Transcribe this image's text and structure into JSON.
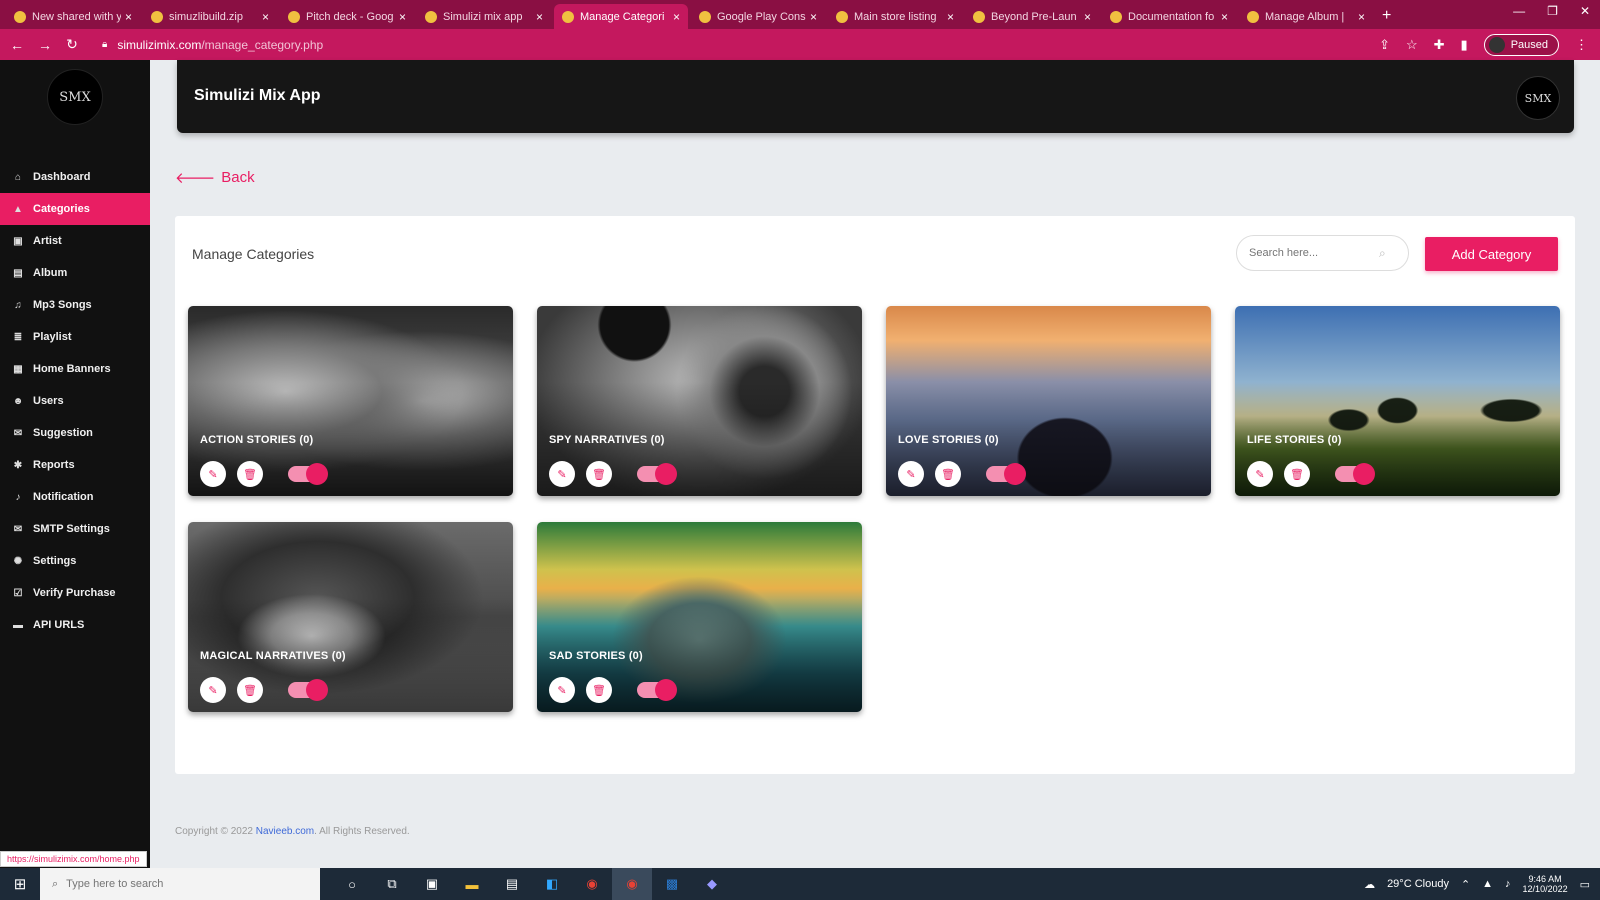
{
  "browser": {
    "tabs": [
      {
        "label": "New shared with y",
        "active": false
      },
      {
        "label": "simuzlibuild.zip",
        "active": false
      },
      {
        "label": "Pitch deck - Goog",
        "active": false
      },
      {
        "label": "Simulizi mix app",
        "active": false
      },
      {
        "label": "Manage Categori",
        "active": true
      },
      {
        "label": "Google Play Cons",
        "active": false
      },
      {
        "label": "Main store listing",
        "active": false
      },
      {
        "label": "Beyond Pre-Laun",
        "active": false
      },
      {
        "label": "Documentation fo",
        "active": false
      },
      {
        "label": "Manage Album |",
        "active": false
      }
    ],
    "url_host": "simulizimix.com",
    "url_path": "/manage_category.php",
    "profile_label": "Paused",
    "status_url": "https://simulizimix.com/home.php"
  },
  "sidebar": {
    "logo_text": "SMX",
    "items": [
      {
        "label": "Dashboard",
        "icon": "home-icon",
        "glyph": "⌂",
        "active": false
      },
      {
        "label": "Categories",
        "icon": "triangle-icon",
        "glyph": "▲",
        "active": true
      },
      {
        "label": "Artist",
        "icon": "user-icon",
        "glyph": "▣",
        "active": false
      },
      {
        "label": "Album",
        "icon": "image-icon",
        "glyph": "▤",
        "active": false
      },
      {
        "label": "Mp3 Songs",
        "icon": "music-icon",
        "glyph": "♫",
        "active": false
      },
      {
        "label": "Playlist",
        "icon": "list-icon",
        "glyph": "≣",
        "active": false
      },
      {
        "label": "Home Banners",
        "icon": "banner-icon",
        "glyph": "▦",
        "active": false
      },
      {
        "label": "Users",
        "icon": "users-icon",
        "glyph": "☻",
        "active": false
      },
      {
        "label": "Suggestion",
        "icon": "comment-icon",
        "glyph": "✉",
        "active": false
      },
      {
        "label": "Reports",
        "icon": "pin-icon",
        "glyph": "✱",
        "active": false
      },
      {
        "label": "Notification",
        "icon": "bell-icon",
        "glyph": "♪",
        "active": false
      },
      {
        "label": "SMTP Settings",
        "icon": "mail-icon",
        "glyph": "✉",
        "active": false
      },
      {
        "label": "Settings",
        "icon": "gear-icon",
        "glyph": "✺",
        "active": false
      },
      {
        "label": "Verify Purchase",
        "icon": "check-icon",
        "glyph": "☑",
        "active": false
      },
      {
        "label": "API URLS",
        "icon": "api-icon",
        "glyph": "▬",
        "active": false
      }
    ]
  },
  "header": {
    "title": "Simulizi Mix App",
    "logo_text": "SMX"
  },
  "back_label": "Back",
  "panel": {
    "title": "Manage Categories",
    "search_placeholder": "Search here...",
    "add_button": "Add Category"
  },
  "categories": [
    {
      "name": "ACTION STORIES (0)",
      "enabled": true,
      "image": "boxing-match"
    },
    {
      "name": "SPY NARRATIVES (0)",
      "enabled": true,
      "image": "revolver"
    },
    {
      "name": "LOVE STORIES (0)",
      "enabled": true,
      "image": "couple-sunset"
    },
    {
      "name": "LIFE STORIES (0)",
      "enabled": true,
      "image": "family-field"
    },
    {
      "name": "MAGICAL NARRATIVES (0)",
      "enabled": true,
      "image": "witch-skull"
    },
    {
      "name": "SAD STORIES (0)",
      "enabled": true,
      "image": "children-lake"
    }
  ],
  "footer": {
    "text": "Copyright © 2022",
    "link": "Navieeb.com",
    "suffix": ". All Rights Reserved."
  },
  "taskbar": {
    "search_placeholder": "Type here to search",
    "weather": "29°C Cloudy",
    "time": "9:46 AM",
    "date": "12/10/2022"
  },
  "colors": {
    "accent": "#e91e63",
    "sidebar_bg": "#111111",
    "browser_bar": "#c4185e"
  }
}
